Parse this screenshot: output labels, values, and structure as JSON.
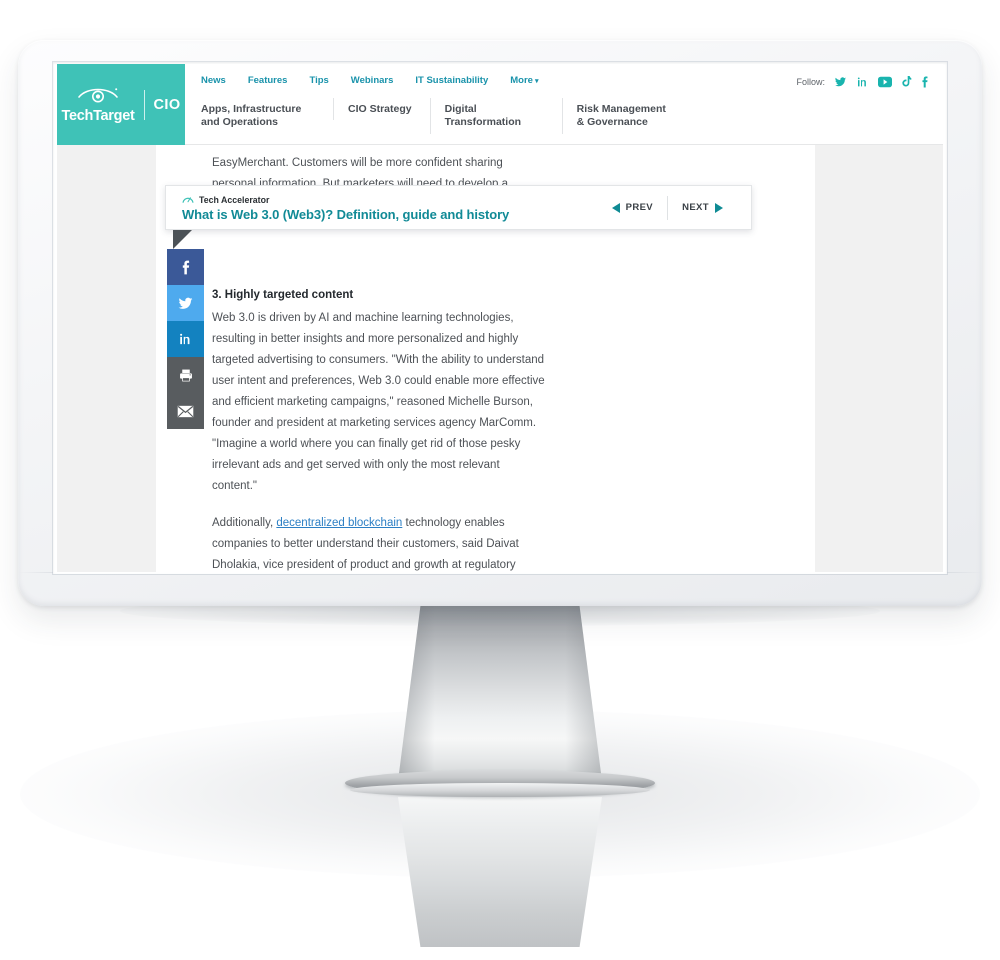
{
  "site": {
    "brand_name": "TechTarget",
    "section_name": "CIO",
    "brand_color": "#3fc2b7",
    "accent_color": "#118a96"
  },
  "top_nav": [
    {
      "label": "News"
    },
    {
      "label": "Features"
    },
    {
      "label": "Tips"
    },
    {
      "label": "Webinars"
    },
    {
      "label": "IT Sustainability"
    },
    {
      "label": "More",
      "caret": "▾"
    }
  ],
  "main_nav": [
    {
      "label": "Apps, Infrastructure and Operations"
    },
    {
      "label": "CIO Strategy"
    },
    {
      "label": "Digital Transformation"
    },
    {
      "label": "Risk Management & Governance"
    }
  ],
  "follow": {
    "label": "Follow:",
    "icons": [
      {
        "name": "twitter-icon"
      },
      {
        "name": "linkedin-icon"
      },
      {
        "name": "youtube-icon"
      },
      {
        "name": "tiktok-icon"
      },
      {
        "name": "facebook-icon"
      }
    ]
  },
  "accelerator": {
    "kicker": "Tech Accelerator",
    "title": "What is Web 3.0 (Web3)? Definition, guide and history",
    "prev_label": "PREV",
    "next_label": "NEXT"
  },
  "share_rail": [
    {
      "name": "facebook-share",
      "glyph": "f",
      "color": "#3b5998"
    },
    {
      "name": "twitter-share",
      "glyph": "",
      "color": "#4eaaee"
    },
    {
      "name": "linkedin-share",
      "glyph": "in",
      "color": "#1382c0"
    },
    {
      "name": "print-share",
      "glyph": "",
      "color": "#585c5f"
    },
    {
      "name": "email-share",
      "glyph": "",
      "color": "#585c5f"
    }
  ],
  "article": {
    "paragraph_top": "EasyMerchant. Customers will be more confident sharing personal information. But marketers will need to develop a",
    "heading": "3. Highly targeted content",
    "paragraph_1": "Web 3.0 is driven by AI and machine learning technologies, resulting in better insights and more personalized and highly targeted advertising to consumers. \"With the ability to understand user intent and preferences, Web 3.0 could enable more effective and efficient marketing campaigns,\" reasoned Michelle Burson, founder and president at marketing services agency MarComm. \"Imagine a world where you can finally get rid of those pesky irrelevant ads and get served with only the most relevant content.\"",
    "paragraph_2_before": "Additionally, ",
    "paragraph_2_link": "decentralized blockchain",
    "paragraph_2_after": " technology enables companies to better understand their customers, said Daivat Dholakia, vice president of product and growth at regulatory lifecycle management software provider Essenvia. \"By utilizing decentralized blockchain technology,\" he explained,"
  }
}
